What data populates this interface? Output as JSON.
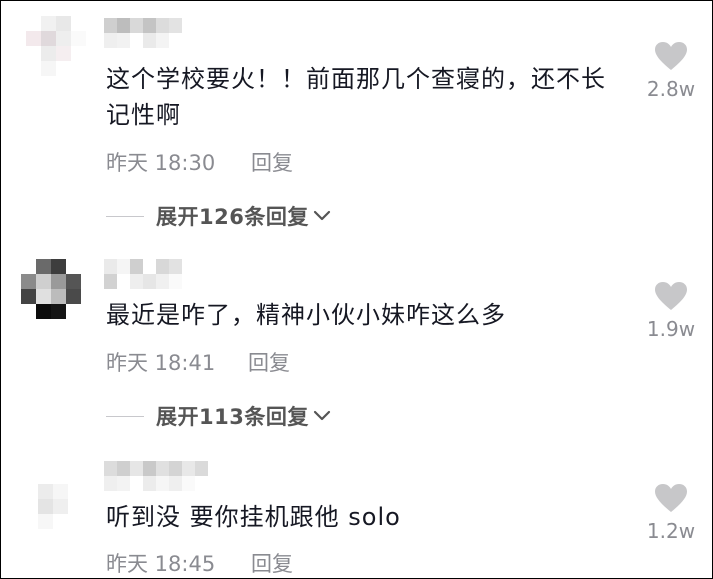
{
  "comments": [
    {
      "text": "这个学校要火！！前面那几个查寝的，还不长记性啊",
      "time": "昨天 18:30",
      "reply_label": "回复",
      "likes": "2.8w",
      "expand_label": "展开126条回复"
    },
    {
      "text": "最近是咋了，精神小伙小妹咋这么多",
      "time": "昨天 18:41",
      "reply_label": "回复",
      "likes": "1.9w",
      "expand_label": "展开113条回复"
    },
    {
      "text": "听到没 要你挂机跟他 solo",
      "time": "昨天 18:45",
      "reply_label": "回复",
      "likes": "1.2w"
    }
  ],
  "colors": {
    "text": "#161823",
    "meta": "#8a8b91",
    "heart": "#c7c7c9",
    "expand": "#555555"
  },
  "icons": {
    "like": "heart-icon",
    "expand": "chevron-down-icon"
  }
}
